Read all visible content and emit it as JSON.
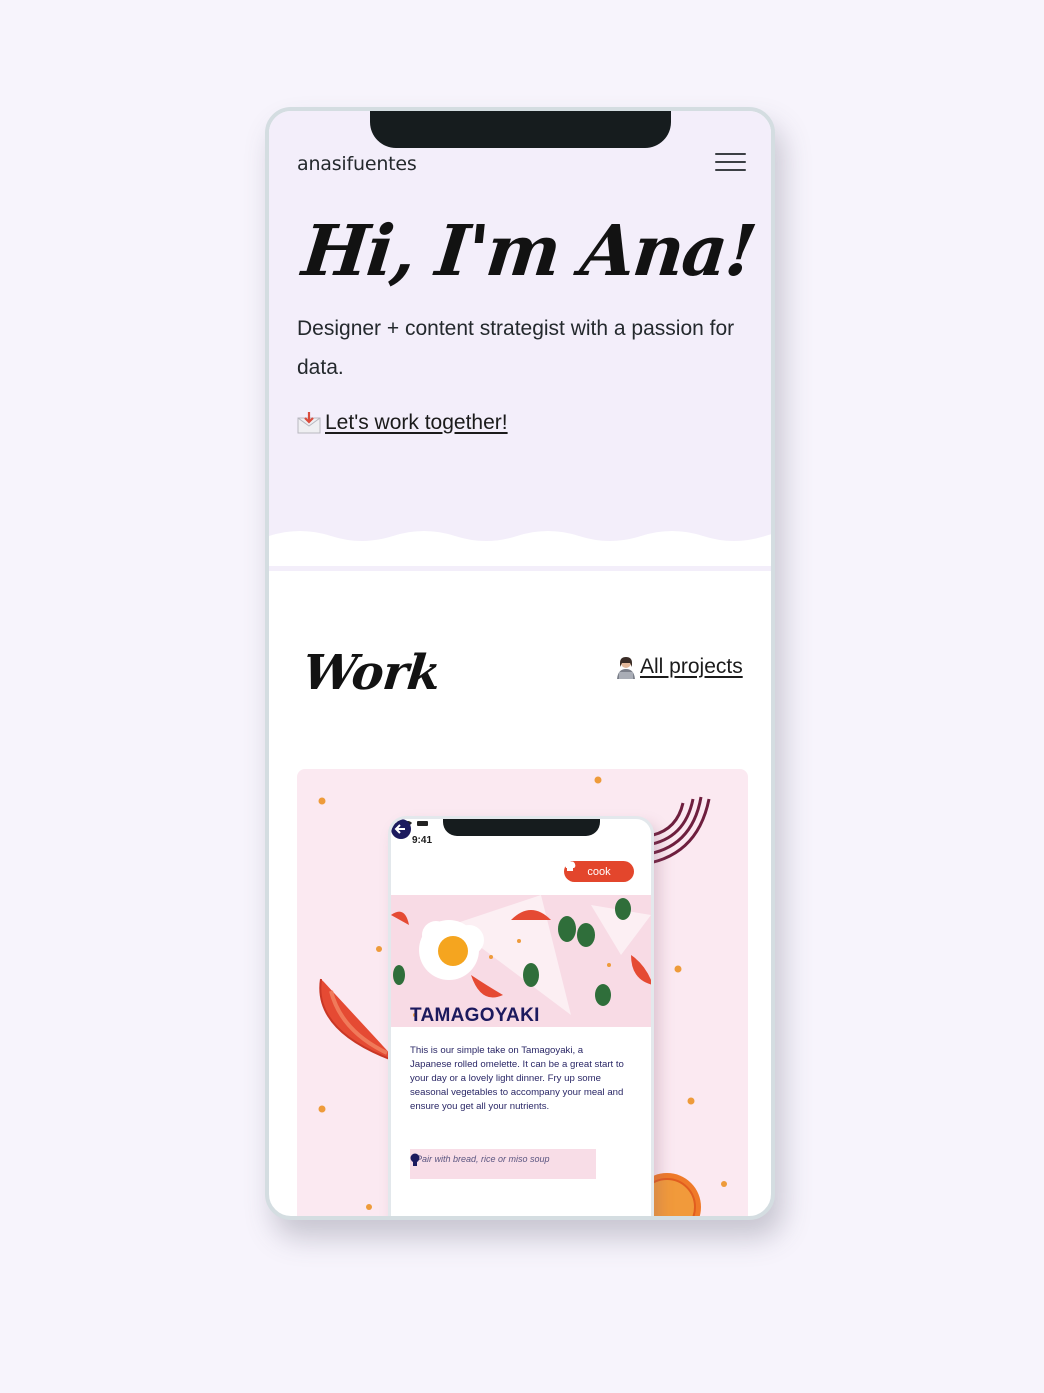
{
  "header": {
    "brand": "anasifuentes",
    "menu_icon": "hamburger-menu-icon"
  },
  "hero": {
    "title": "Hi, I'm Ana!",
    "subtitle": "Designer + content strategist with a passion for data.",
    "cta_icon": "envelope-icon",
    "cta_label": "Let's work together!"
  },
  "work": {
    "title": "Work",
    "all_projects_icon": "person-at-laptop-icon",
    "all_projects_label": "All projects"
  },
  "project_card": {
    "phone_time": "9:41",
    "cook_label": "cook",
    "heading": "TAMAGOYAKI",
    "description": "This is our simple take on Tamagoyaki, a Japanese rolled omelette. It can be a great start to your day or a lovely light dinner. Fry up some seasonal vegetables to accompany your meal and ensure you get all your nutrients.",
    "tip": "Pair with bread, rice or miso soup"
  },
  "colors": {
    "page_bg": "#f7f4fc",
    "hero_bg": "#f3eefa",
    "card_bg": "#fbe9f1",
    "accent_red": "#e3462c",
    "navy": "#1c1a5e"
  }
}
